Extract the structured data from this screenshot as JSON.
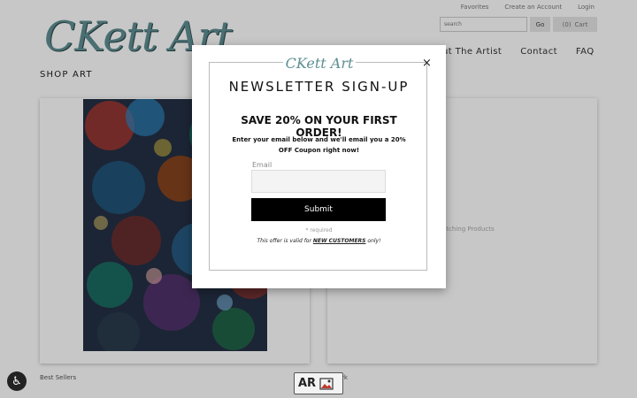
{
  "header": {
    "logo_text": "CKett Art",
    "top_links": [
      "Favorites",
      "Create an Account",
      "Login"
    ],
    "search_placeholder": "search",
    "go_label": "Go",
    "cart_count": "(0)",
    "cart_label": "Cart",
    "nav": [
      "ut The Artist",
      "Contact",
      "FAQ"
    ]
  },
  "main": {
    "shop_title": "SHOP ART",
    "matching_text": "atching Products",
    "best_sellers": "Best Sellers",
    "work_label": "rk"
  },
  "badges": {
    "ar_label": "AR"
  },
  "modal": {
    "logo_text": "CKett Art",
    "close_symbol": "×",
    "title": "NEWSLETTER SIGN-UP",
    "headline": "SAVE 20% ON YOUR FIRST ORDER!",
    "description": "Enter your email below and we'll email you a 20% OFF Coupon right now!",
    "email_label": "Email",
    "submit_label": "Submit",
    "required_note": "* required",
    "offer_prefix": "This offer is valid for ",
    "offer_emphasis": "NEW CUSTOMERS",
    "offer_suffix": " only!"
  },
  "colors": {
    "brand": "#5f8f92",
    "submit_bg": "#000000"
  }
}
